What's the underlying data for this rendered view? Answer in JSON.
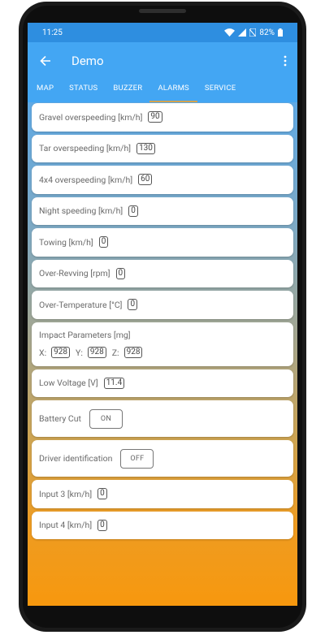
{
  "status_bar": {
    "time": "11:25",
    "battery": "82%"
  },
  "app_bar": {
    "title": "Demo"
  },
  "tabs": [
    {
      "label": "MAP"
    },
    {
      "label": "STATUS"
    },
    {
      "label": "BUZZER"
    },
    {
      "label": "ALARMS",
      "active": true
    },
    {
      "label": "SERVICE"
    }
  ],
  "alarms": {
    "gravel": {
      "label": "Gravel overspeeding [km/h]",
      "value": "90"
    },
    "tar": {
      "label": "Tar overspeeding [km/h]",
      "value": "130"
    },
    "x4x4": {
      "label": "4x4 overspeeding [km/h]",
      "value": "60"
    },
    "night": {
      "label": "Night speeding [km/h]",
      "value": "0"
    },
    "towing": {
      "label": "Towing [km/h]",
      "value": "0"
    },
    "revving": {
      "label": "Over-Revving [rpm]",
      "value": "0"
    },
    "temperature": {
      "label": "Over-Temperature [°C]",
      "value": "0"
    },
    "impact": {
      "label": "Impact Parameters [mg]",
      "x_label": "X:",
      "x_value": "928",
      "y_label": "Y:",
      "y_value": "928",
      "z_label": "Z:",
      "z_value": "928"
    },
    "low_voltage": {
      "label": "Low Voltage [V]",
      "value": "11.4"
    },
    "battery_cut": {
      "label": "Battery Cut",
      "state": "ON"
    },
    "driver_id": {
      "label": "Driver identification",
      "state": "OFF"
    },
    "input3": {
      "label": "Input 3 [km/h]",
      "value": "0"
    },
    "input4": {
      "label": "Input 4 [km/h]",
      "value": "0"
    }
  },
  "colors": {
    "app_bar": "#43a6f3",
    "status_bar": "#2e8ee0",
    "tab_indicator": "#d3a24f",
    "gradient_top": "#49b3f8",
    "gradient_bottom": "#f7980e"
  }
}
